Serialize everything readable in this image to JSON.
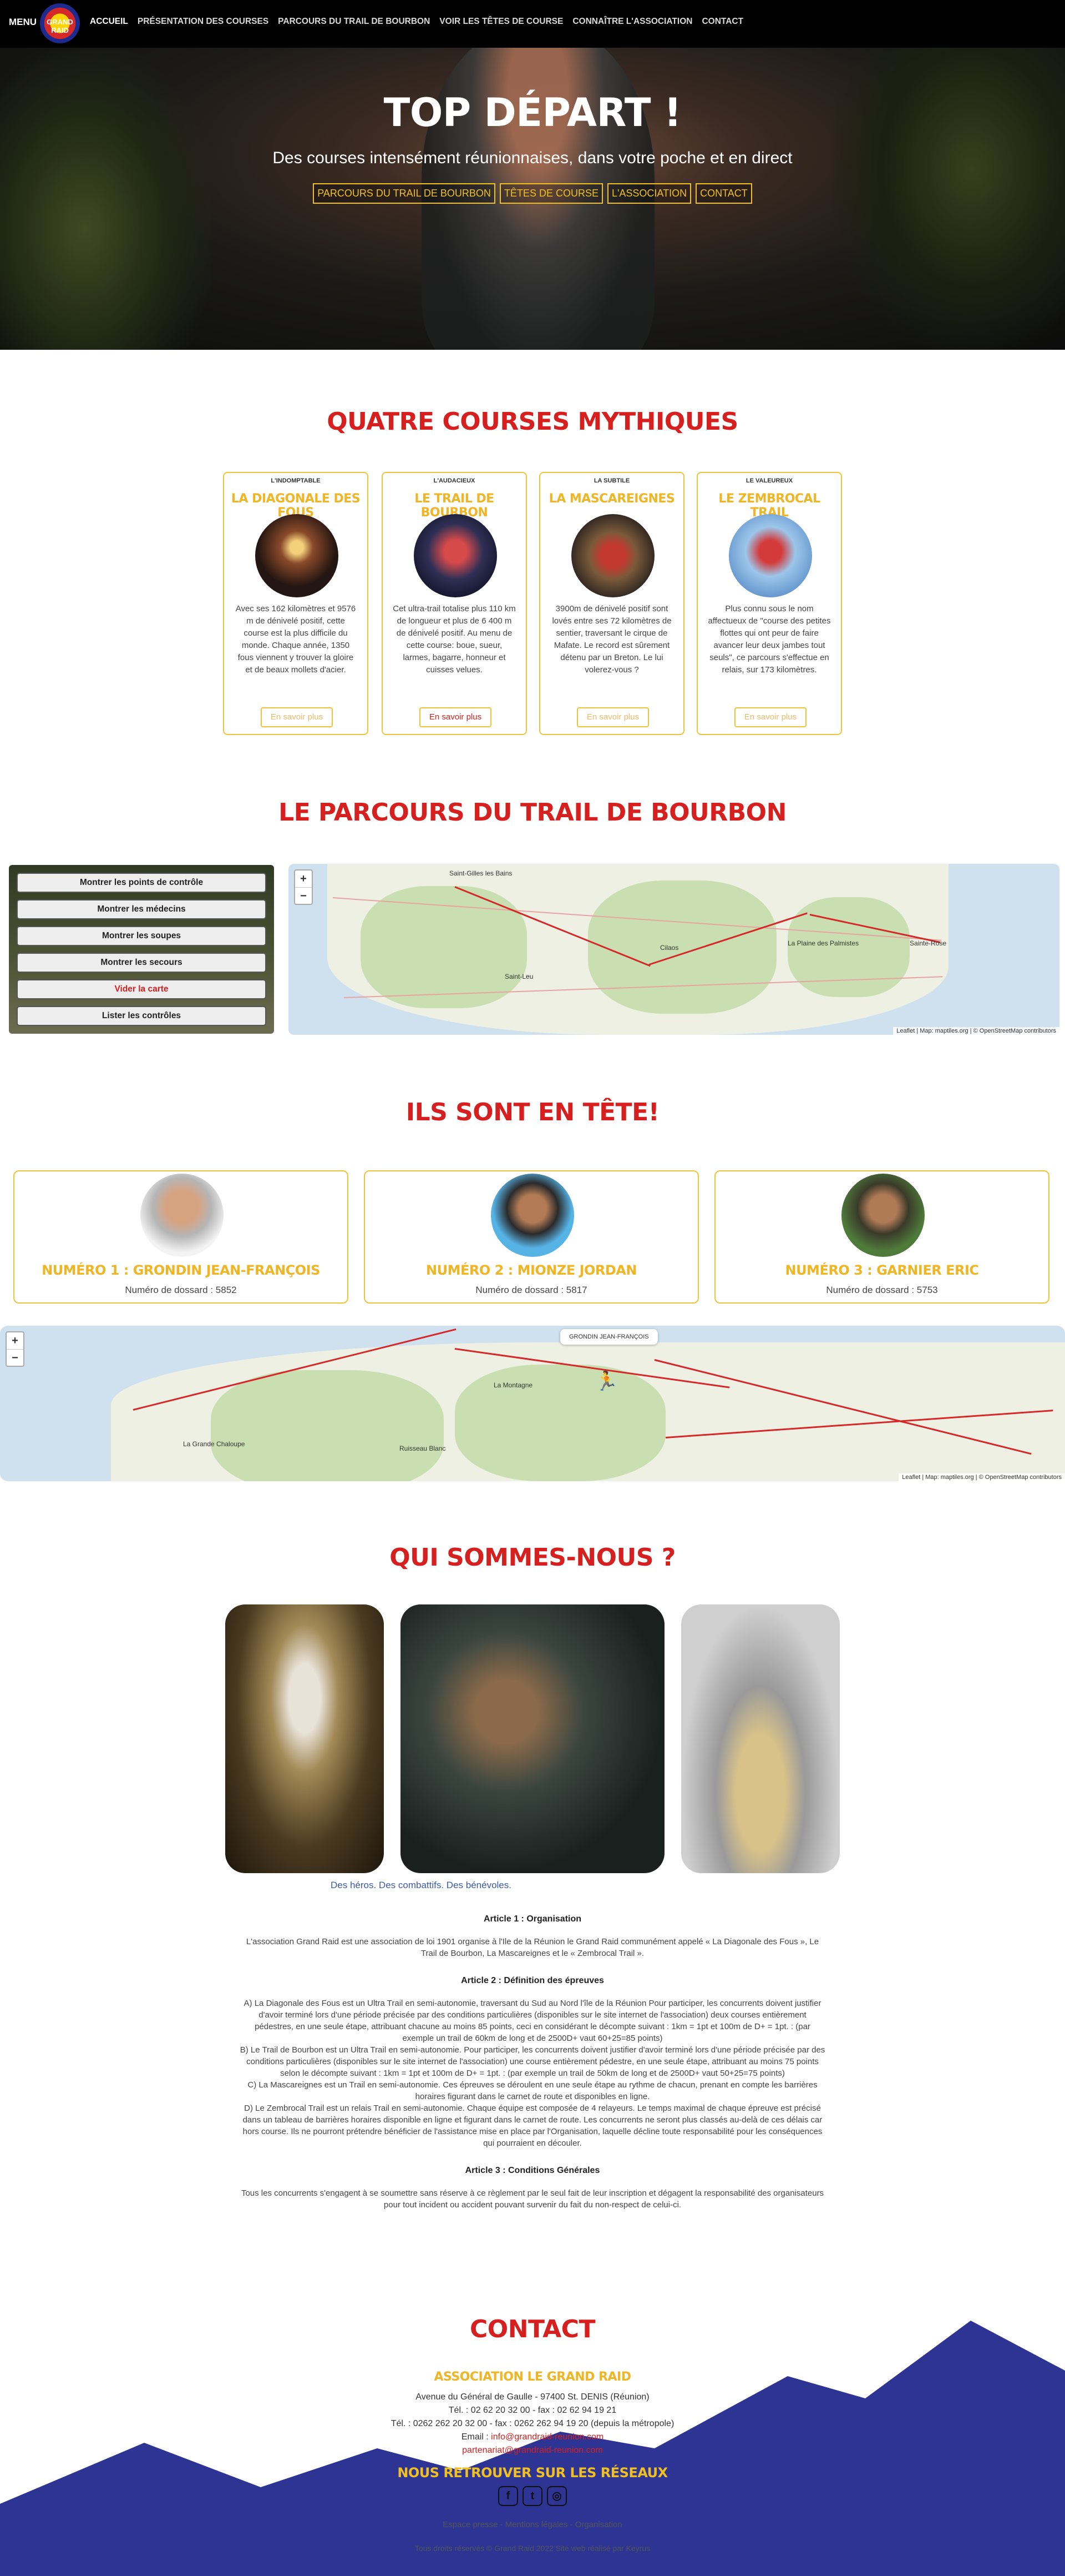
{
  "nav": {
    "menu_label": "MENU",
    "logo_text": "GRAND RAID",
    "items": [
      {
        "label": "ACCUEIL"
      },
      {
        "label": "PRÉSENTATION DES COURSES"
      },
      {
        "label": "PARCOURS DU TRAIL DE BOURBON"
      },
      {
        "label": "VOIR LES TÊTES DE COURSE"
      },
      {
        "label": "CONNAÎTRE L'ASSOCIATION"
      },
      {
        "label": "CONTACT"
      }
    ]
  },
  "hero": {
    "title": "TOP DÉPART !",
    "subtitle": "Des courses intensément réunionnaises, dans votre poche et en direct",
    "buttons": [
      "PARCOURS DU TRAIL DE BOURBON",
      "TÊTES DE COURSE",
      "L'ASSOCIATION",
      "CONTACT"
    ]
  },
  "races": {
    "title": "QUATRE COURSES MYTHIQUES",
    "cards": [
      {
        "tag": "L'INDOMPTABLE",
        "name": "LA DIAGONALE DES FOUS",
        "desc": "Avec ses 162 kilomètres et 9576 m de dénivelé positif, cette course est la plus difficile du monde. Chaque année, 1350 fous viennent y trouver la gloire et de beaux mollets d'acier.",
        "more": "En savoir plus"
      },
      {
        "tag": "L'AUDACIEUX",
        "name": "LE TRAIL DE BOURBON",
        "desc": "Cet ultra-trail totalise plus 110 km de longueur et plus de 6 400 m de dénivelé positif. Au menu de cette course: boue, sueur, larmes, bagarre, honneur et cuisses velues.",
        "more": "En savoir plus"
      },
      {
        "tag": "LA SUBTILE",
        "name": "LA MASCAREIGNES",
        "desc": "3900m de dénivelé positif sont lovés entre ses 72 kilomètres de sentier, traversant le cirque de Mafate. Le record est sûrement détenu par un Breton. Le lui volerez-vous ?",
        "more": "En savoir plus"
      },
      {
        "tag": "LE VALEUREUX",
        "name": "LE ZEMBROCAL TRAIL",
        "desc": "Plus connu sous le nom affectueux de \"course des petites flottes qui ont peur de faire avancer leur deux jambes tout seuls\", ce parcours s'effectue en relais, sur 173 kilomètres.",
        "more": "En savoir plus"
      }
    ]
  },
  "parcours": {
    "title": "LE PARCOURS DU TRAIL DE BOURBON",
    "controls": [
      "Montrer les points de contrôle",
      "Montrer les médecins",
      "Montrer les soupes",
      "Montrer les secours",
      "Vider la carte",
      "Lister les contrôles"
    ],
    "zoom_in": "+",
    "zoom_out": "−",
    "places": [
      "Saint-Gilles les Bains",
      "Cilaos",
      "La Plaine des Palmistes",
      "Sainte-Rose",
      "Saint-Leu"
    ],
    "attribution": "Leaflet | Map: maptiles.org | © OpenStreetMap contributors"
  },
  "leaders": {
    "title": "ILS SONT EN TÊTE!",
    "items": [
      {
        "rank": "NUMÉRO 1 : GRONDIN JEAN-FRANÇOIS",
        "bib": "Numéro de dossard : 5852"
      },
      {
        "rank": "NUMÉRO 2 : MIONZE JORDAN",
        "bib": "Numéro de dossard : 5817"
      },
      {
        "rank": "NUMÉRO 3 : GARNIER ERIC",
        "bib": "Numéro de dossard : 5753"
      }
    ],
    "map_popup": "GRONDIN JEAN-FRANÇOIS",
    "places": [
      "La Montagne",
      "Ruisseau Blanc",
      "La Grande Chaloupe"
    ],
    "attribution": "Leaflet | Map: maptiles.org | © OpenStreetMap contributors"
  },
  "about": {
    "title": "QUI SOMMES-NOUS ?",
    "caption": "Des héros. Des combattifs. Des bénévoles.",
    "article1_title": "Article 1 : Organisation",
    "article1_text": "L'association Grand Raid est une association de loi 1901 organise à l'Ile de la Réunion le Grand Raid communément appelé « La Diagonale des Fous », Le Trail de Bourbon, La Mascareignes et le « Zembrocal Trail ».",
    "article2_title": "Article 2 : Définition des épreuves",
    "article2_a": "A) La Diagonale des Fous est un Ultra Trail en semi-autonomie, traversant du Sud au Nord l'île de la Réunion Pour participer, les concurrents doivent justifier d'avoir terminé lors d'une période précisée par des conditions particulières (disponibles sur le site internet de l'association) deux courses entièrement pédestres, en une seule étape, attribuant chacune au moins 85 points, ceci en considérant le décompte suivant : 1km = 1pt et 100m de D+ = 1pt. : (par exemple un trail de 60km de long et de 2500D+ vaut 60+25=85 points)",
    "article2_b": "B) Le Trail de Bourbon est un Ultra Trail en semi-autonomie. Pour participer, les concurrents doivent justifier d'avoir terminé lors d'une période précisée par des conditions particulières (disponibles sur le site internet de l'association) une course entièrement pédestre, en une seule étape, attribuant au moins 75 points selon le décompte suivant : 1km = 1pt et 100m de D+ = 1pt. : (par exemple un trail de 50km de long et de 2500D+ vaut 50+25=75 points)",
    "article2_c": "C) La Mascareignes est un Trail en semi-autonomie. Ces épreuves se déroulent en une seule étape au rythme de chacun, prenant en compte les barrières horaires figurant dans le carnet de route et disponibles en ligne.",
    "article2_d": "D) Le Zembrocal Trail est un relais Trail en semi-autonomie. Chaque équipe est composée de 4 relayeurs. Le temps maximal de chaque épreuve est précisé dans un tableau de barrières horaires disponible en ligne et figurant dans le carnet de route. Les concurrents ne seront plus classés au-delà de ces délais car hors course. Ils ne pourront prétendre bénéficier de l'assistance mise en place par l'Organisation, laquelle décline toute responsabilité pour les conséquences qui pourraient en découler.",
    "article3_title": "Article 3 : Conditions Générales",
    "article3_text": "Tous les concurrents s'engagent à se soumettre sans réserve à ce règlement par le seul fait de leur inscription et dégagent la responsabilité des organisateurs pour tout incident ou accident pouvant survenir du fait du non-respect de celui-ci."
  },
  "contact": {
    "title": "CONTACT",
    "assoc_name": "ASSOCIATION LE GRAND RAID",
    "address": "Avenue du Général de Gaulle - 97400 St. DENIS (Réunion)",
    "phone": "Tél. : 02 62 20 32 00 - fax : 02 62 94 19 21",
    "phone2": "Tél. : 0262 262 20 32 00 - fax : 0262 262 94 19 20 (depuis la métropole)",
    "email_label": "Email :",
    "email": "info@grandraid-reunion.com",
    "email2": "partenariat@grandraid-reunion.com",
    "social_title": "NOUS RETROUVER SUR LES RÉSEAUX",
    "social": [
      "f",
      "t",
      "◎"
    ],
    "footer_links": "Espace presse - Mentions légales - Organisation",
    "copyright": "Tous droits réservés © Grand Raid 2022 Site web réalisé par Keyrus",
    "colors": {
      "mountain": "#2d3494",
      "accent": "#d6201f",
      "gold": "#f0b523"
    }
  }
}
